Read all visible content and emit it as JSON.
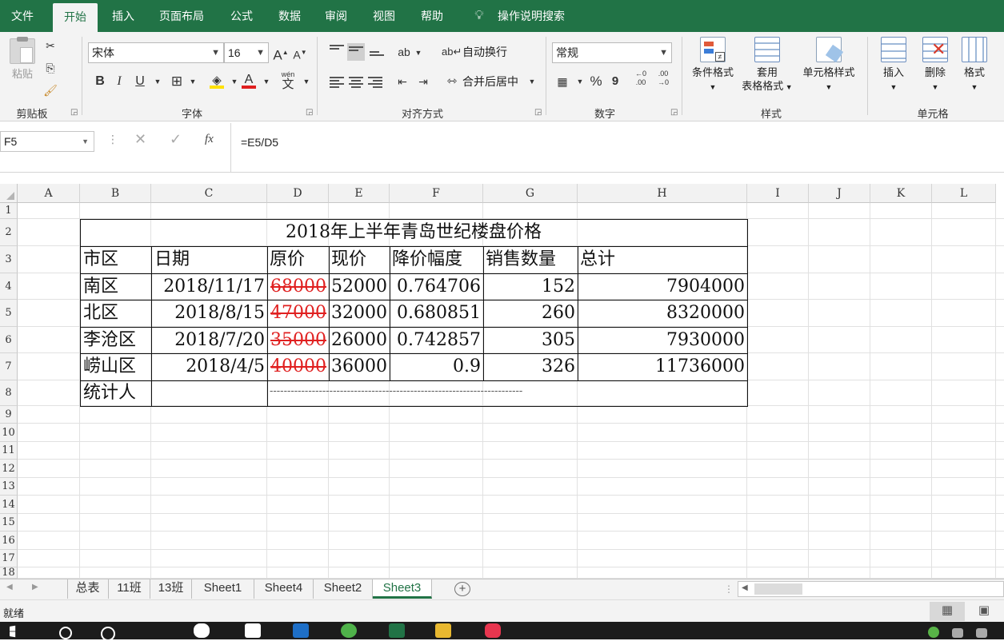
{
  "ribbon": {
    "tabs": [
      "文件",
      "开始",
      "插入",
      "页面布局",
      "公式",
      "数据",
      "审阅",
      "视图",
      "帮助"
    ],
    "active_tab": "开始",
    "tell_me": "操作说明搜索",
    "clipboard": {
      "paste": "粘贴",
      "label": "剪贴板"
    },
    "font": {
      "name": "宋体",
      "size": "16",
      "bold": "B",
      "italic": "I",
      "underline": "U",
      "grow": "A",
      "shrink": "A",
      "phonetic": "wén",
      "phonetic_char": "文",
      "label": "字体"
    },
    "alignment": {
      "wrap_text": "自动换行",
      "merge_center": "合并后居中",
      "label": "对齐方式"
    },
    "number": {
      "format": "常规",
      "percent": "%",
      "comma": "9",
      "label": "数字"
    },
    "styles": {
      "conditional": "条件格式",
      "table_format_line1": "套用",
      "table_format_line2": "表格格式",
      "cell_styles": "单元格样式",
      "label": "样式"
    },
    "cells": {
      "insert": "插入",
      "delete": "删除",
      "format": "格式",
      "label": "单元格"
    }
  },
  "formula_bar": {
    "name_box": "F5",
    "fx": "fx",
    "formula": "=E5/D5"
  },
  "grid": {
    "columns": [
      "A",
      "B",
      "C",
      "D",
      "E",
      "F",
      "G",
      "H",
      "I",
      "J",
      "K",
      "L"
    ],
    "rows": [
      "1",
      "2",
      "3",
      "4",
      "5",
      "6",
      "7",
      "8",
      "9",
      "10",
      "11",
      "12",
      "13",
      "14",
      "15",
      "16",
      "17",
      "18"
    ],
    "title": "2018年上半年青岛世纪楼盘价格",
    "headers": [
      "市区",
      "日期",
      "原价",
      "现价",
      "降价幅度",
      "销售数量",
      "总计"
    ],
    "data": [
      {
        "district": "南区",
        "date": "2018/11/17",
        "orig": "68000",
        "now": "52000",
        "ratio": "0.764706",
        "qty": "152",
        "total": "7904000"
      },
      {
        "district": "北区",
        "date": "2018/8/15",
        "orig": "47000",
        "now": "32000",
        "ratio": "0.680851",
        "qty": "260",
        "total": "8320000"
      },
      {
        "district": "李沧区",
        "date": "2018/7/20",
        "orig": "35000",
        "now": "26000",
        "ratio": "0.742857",
        "qty": "305",
        "total": "7930000"
      },
      {
        "district": "崂山区",
        "date": "2018/4/5",
        "orig": "40000",
        "now": "36000",
        "ratio": "0.9",
        "qty": "326",
        "total": "11736000"
      }
    ],
    "stat_label": "统计人",
    "stat_line": "------------------------------------------------------------------------"
  },
  "sheets": [
    "总表",
    "11班",
    "13班",
    "Sheet1",
    "Sheet4",
    "Sheet2",
    "Sheet3"
  ],
  "active_sheet": "Sheet3",
  "status": {
    "mode": "就绪"
  },
  "colors": {
    "ribbon_green": "#217346",
    "strike_red": "#e02020"
  }
}
